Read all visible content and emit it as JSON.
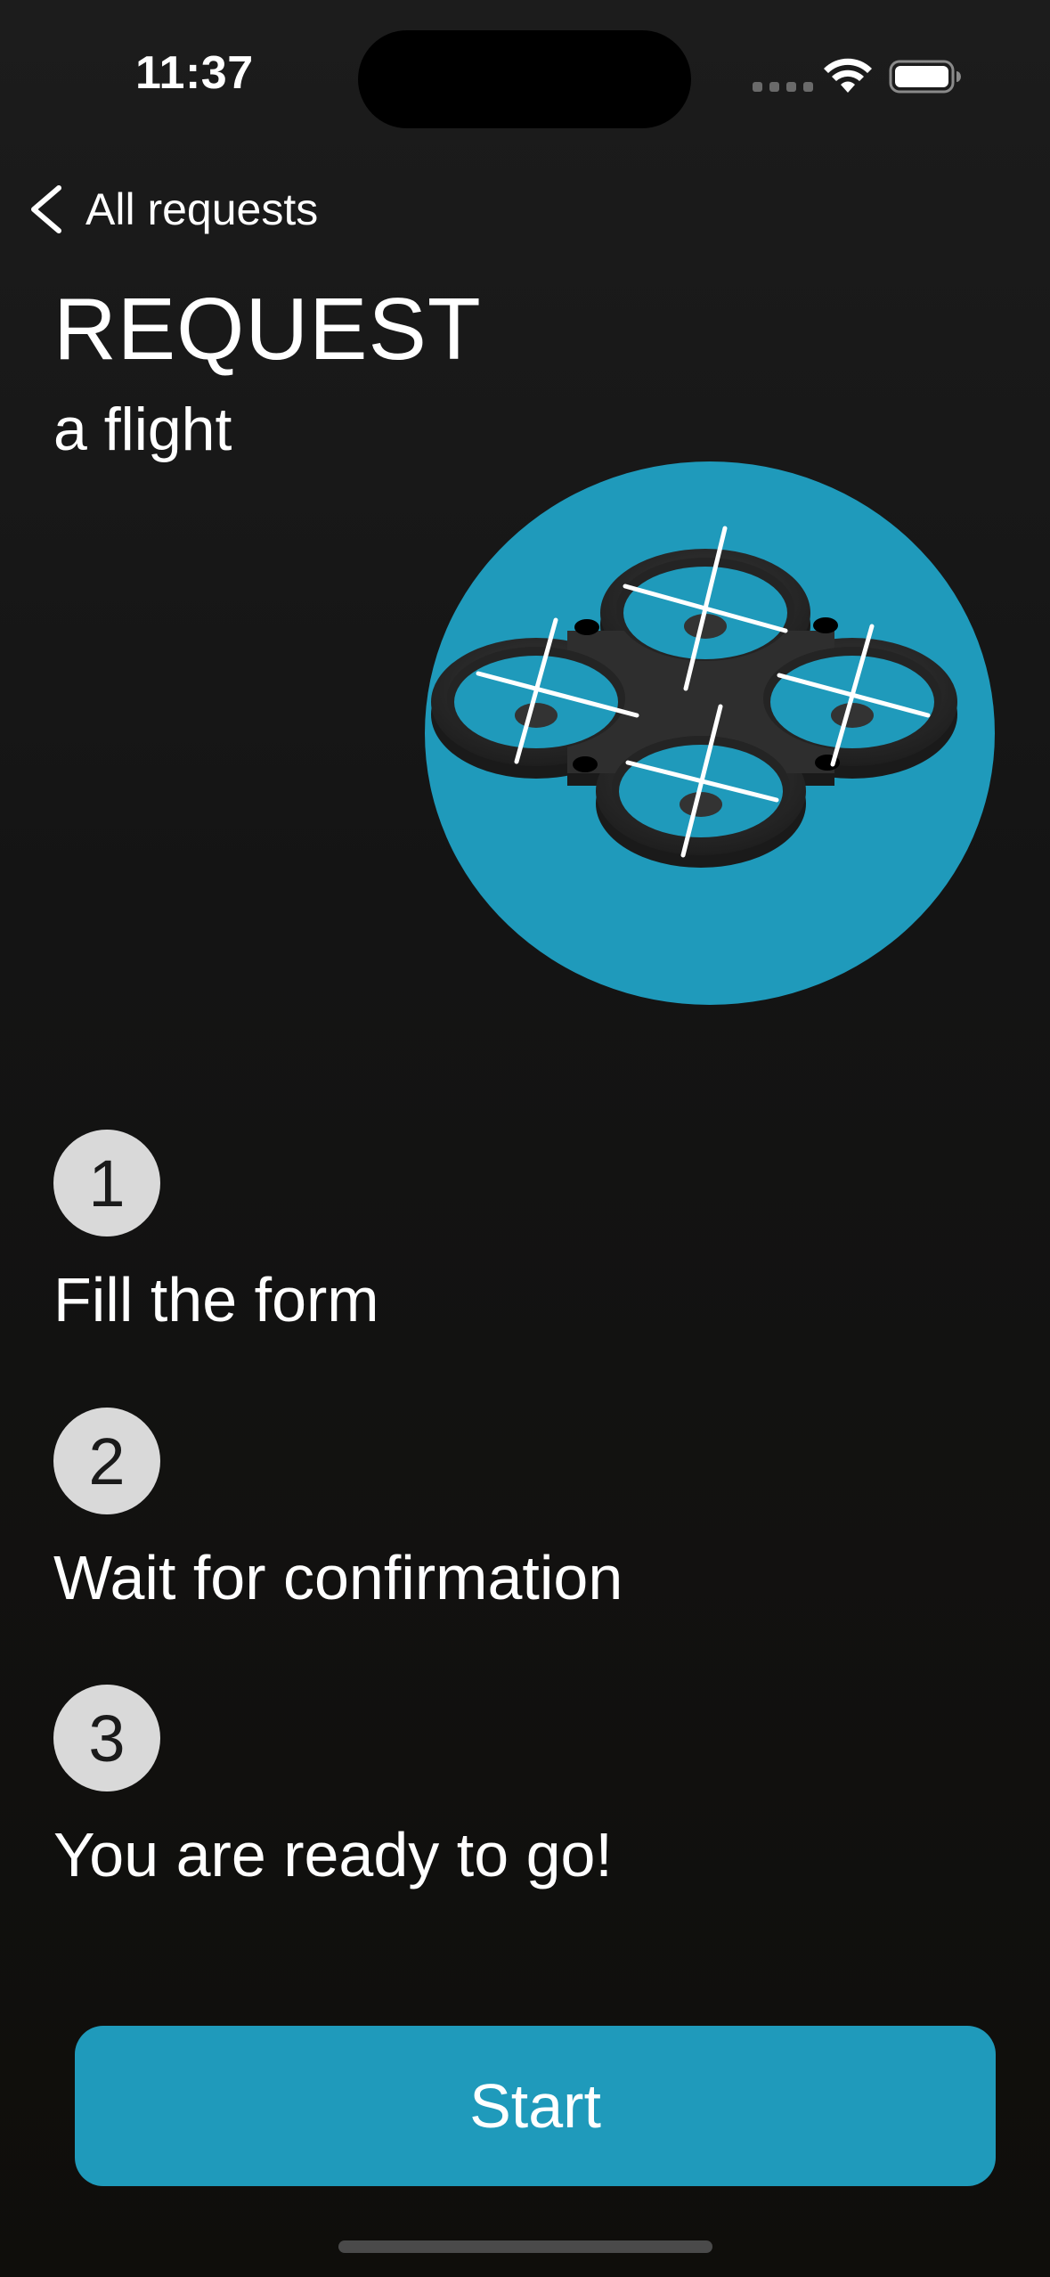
{
  "status_bar": {
    "time": "11:37"
  },
  "nav": {
    "back_label": "All requests",
    "back_icon": "chevron-left-icon"
  },
  "header": {
    "title": "REQUEST",
    "subtitle": "a flight"
  },
  "hero": {
    "icon": "drone-illustration",
    "background_color": "#1f9abb"
  },
  "steps": [
    {
      "number": "1",
      "text": "Fill the form"
    },
    {
      "number": "2",
      "text": "Wait for confirmation"
    },
    {
      "number": "3",
      "text": "You are ready to go!"
    }
  ],
  "actions": {
    "start_label": "Start"
  },
  "colors": {
    "accent": "#1f9abb",
    "background": "#151515",
    "step_badge": "#d9d9d9"
  }
}
